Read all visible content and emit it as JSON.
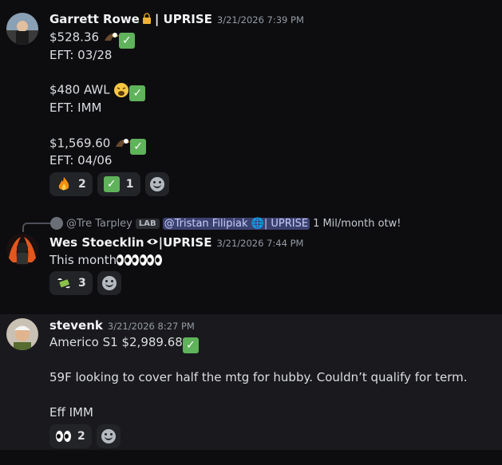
{
  "messages": [
    {
      "author": "Garrett Rowe",
      "author_suffix": "| UPRISE",
      "timestamp": "3/21/2026 7:39 PM",
      "lines": [
        "$528.36",
        "EFT: 03/28",
        "$480 AWL",
        "EFT: IMM",
        "$1,569.60",
        "EFT: 04/06"
      ],
      "reactions": [
        {
          "emoji": "fire",
          "count": "2"
        },
        {
          "emoji": "check",
          "count": "1"
        }
      ]
    },
    {
      "reply": {
        "author": "@Tre Tarpley",
        "tag": "LAB",
        "mention": "@Tristan Filipiak",
        "mention_suffix": "| UPRISE",
        "text": "1 Mil/month otw!"
      },
      "author": "Wes Stoecklin",
      "author_suffix": "|UPRISE",
      "timestamp": "3/21/2026 7:44 PM",
      "lines": [
        "This month"
      ],
      "reactions": [
        {
          "emoji": "money",
          "count": "3"
        }
      ]
    },
    {
      "author": "stevenk",
      "timestamp": "3/21/2026 8:27 PM",
      "lines": [
        "Americo S1 $2,989.68",
        "59F looking to cover half the mtg for hubby. Couldn’t qualify for term.",
        "Eff IMM"
      ],
      "reactions": [
        {
          "emoji": "eyes",
          "count": "2"
        }
      ]
    }
  ],
  "icons": {
    "lock": "lock-icon",
    "eagle": "eagle-icon",
    "check": "white-check-mark-icon",
    "tired": "tired-face-icon",
    "fire": "fire-icon",
    "money": "money-with-wings-icon",
    "eyes": "eyes-icon",
    "eye": "eye-icon",
    "globe": "globe-icon",
    "add_reaction": "add-reaction-icon"
  },
  "colors": {
    "background": "#0d0d10",
    "highlight": "#1a1a1e",
    "reaction_bg": "#232428",
    "mention_bg": "#3c4270",
    "check_green": "#5fb35a"
  }
}
